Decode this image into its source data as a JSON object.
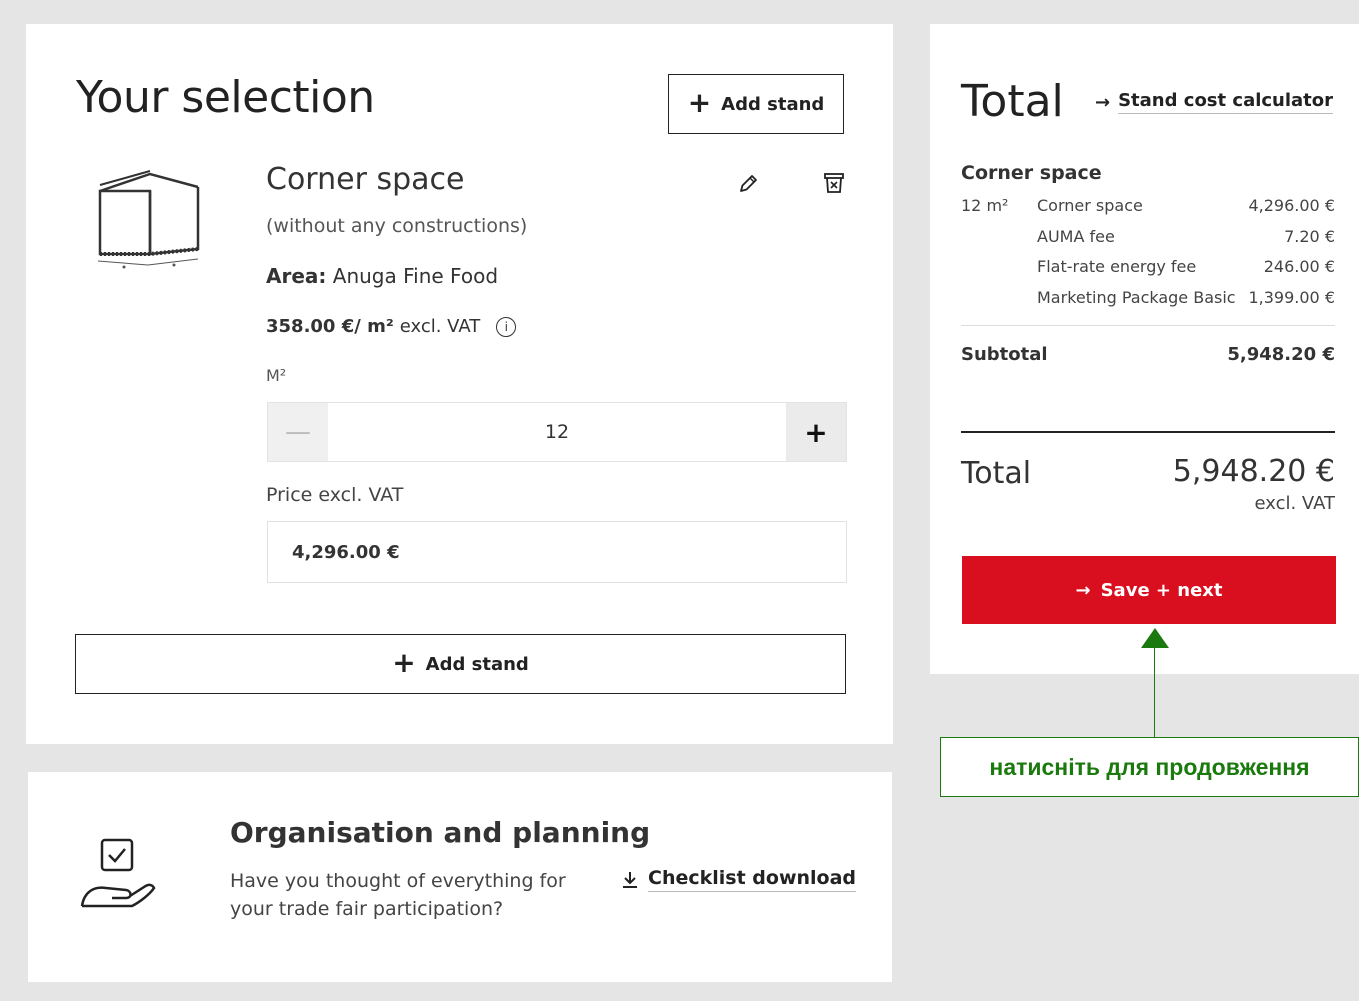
{
  "selection": {
    "title": "Your selection",
    "add_stand_top": "Add stand",
    "add_stand_bottom": "Add stand",
    "stand": {
      "name": "Corner space",
      "subtitle": "(without any constructions)",
      "area_label": "Area:",
      "area_value": "Anuga Fine Food",
      "price_per_m2": "358.00 €/ m²",
      "price_suffix": "excl. VAT",
      "m2_label": "M²",
      "quantity": "12",
      "price_label": "Price excl. VAT",
      "price_value": "4,296.00 €"
    }
  },
  "organisation": {
    "title": "Organisation and planning",
    "text": "Have you thought of everything for your trade fair participation?",
    "checklist_label": "Checklist download"
  },
  "total": {
    "title": "Total",
    "calculator_link": "Stand cost calculator",
    "group_title": "Corner space",
    "qty": "12 m²",
    "lines": [
      {
        "name": "Corner space",
        "value": "4,296.00 €"
      },
      {
        "name": "AUMA fee",
        "value": "7.20 €"
      },
      {
        "name": "Flat-rate energy fee",
        "value": "246.00 €"
      },
      {
        "name": "Marketing Package Basic",
        "value": "1,399.00 €"
      }
    ],
    "subtotal_label": "Subtotal",
    "subtotal_value": "5,948.20 €",
    "grand_label": "Total",
    "grand_value": "5,948.20 €",
    "grand_note": "excl. VAT",
    "save_label": "Save + next"
  },
  "callout": {
    "text": "натисніть для продовження"
  },
  "colors": {
    "accent_red": "#d90e1e",
    "callout_green": "#1b7a0d"
  }
}
